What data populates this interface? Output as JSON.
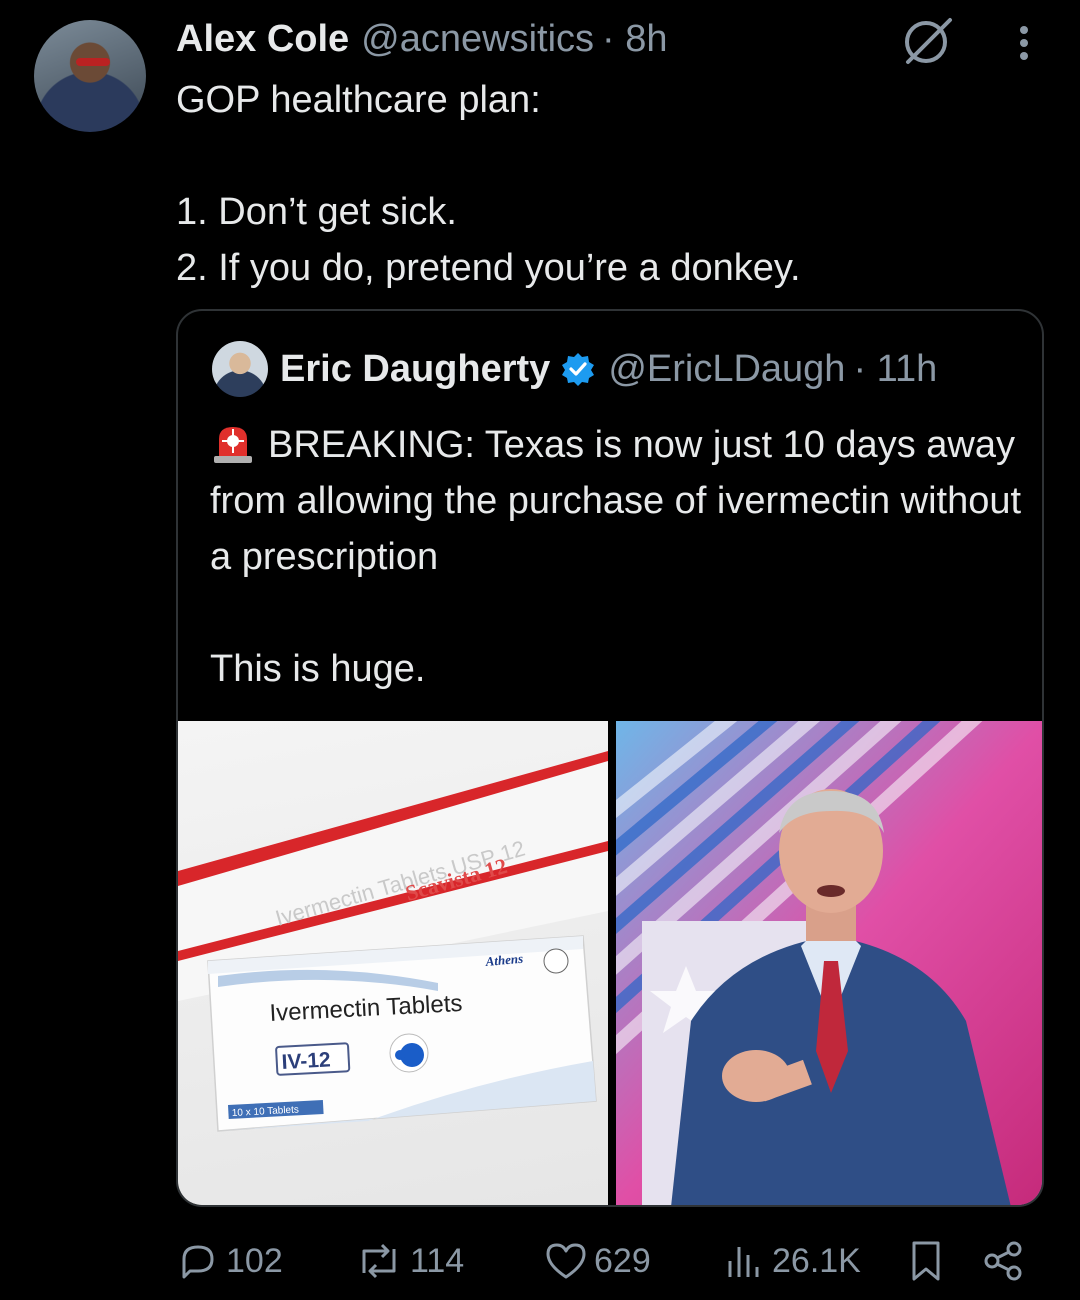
{
  "tweet": {
    "author_name": "Alex Cole",
    "author_handle": "@acnewsitics",
    "time": "· 8h",
    "text": "GOP healthcare plan:\n\n1. Don’t get sick.\n2. If you do, pretend you’re a donkey."
  },
  "quoted": {
    "author_name": "Eric Daugherty",
    "author_handle": "@EricLDaugh",
    "time": "· 11h",
    "text_main": "BREAKING: Texas is now just 10 days away from allowing the purchase of ivermectin without a prescription\n\nThis is huge.",
    "image_left": {
      "box_label": "Ivermectin Tablets",
      "box_brand": "IV-12",
      "box_maker": "Athens",
      "box_count": "10 x 10 Tablets",
      "back_box_text": "Ivermectin Tablets USP 12",
      "back_box_brand": "Scavista 12"
    }
  },
  "actions": {
    "replies": "102",
    "reposts": "114",
    "likes": "629",
    "views": "26.1K"
  },
  "icons": [
    "grok-icon",
    "more-icon",
    "verified-icon",
    "siren-icon",
    "reply-icon",
    "repost-icon",
    "like-icon",
    "views-icon",
    "bookmark-icon",
    "share-icon"
  ],
  "colors": {
    "background": "#000000",
    "text": "#e7e9ea",
    "secondary": "#8b98a5",
    "verified": "#1d9bf0",
    "border": "#2f3336"
  }
}
